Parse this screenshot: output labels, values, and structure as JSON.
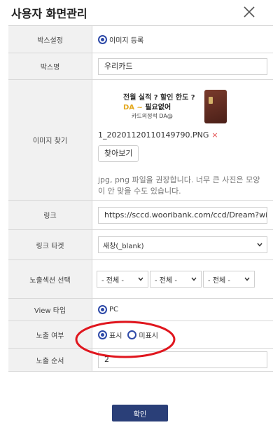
{
  "modal": {
    "title": "사용자 화면관리"
  },
  "form": {
    "box_setting": {
      "label": "박스설정",
      "option": "이미지 등록"
    },
    "box_name": {
      "label": "박스명",
      "value": "우리카드"
    },
    "image": {
      "label": "이미지 찾기",
      "banner": {
        "line1": "전월 실적 ?  할인 한도 ?",
        "line2_highlight": "DA ~",
        "line2_rest": " 필요없어",
        "line3": "카드의정석 DA@"
      },
      "filename": "1_20201120110149790.PNG",
      "remove_icon": "×",
      "find_button": "찾아보기",
      "hint": "jpg, png 파일을 권장합니다. 너무 큰 사진은 모양이 안 맞을 수도 있습니다."
    },
    "link": {
      "label": "링크",
      "value": "https://sccd.wooribank.com/ccd/Dream?withyou"
    },
    "link_target": {
      "label": "링크 타겟",
      "value": "새창(_blank)"
    },
    "exposure_section": {
      "label": "노출섹션 선택",
      "selects": [
        "- 전체 -",
        "- 전체 -",
        "- 전체 -"
      ]
    },
    "view_type": {
      "label": "View 타입",
      "option": "PC"
    },
    "display": {
      "label": "노출 여부",
      "options": [
        "표시",
        "미표시"
      ],
      "selected_index": 0
    },
    "order": {
      "label": "노출 순서",
      "value": "2"
    }
  },
  "confirm_button": "확인",
  "colors": {
    "accent": "#2e4aa8",
    "confirm_bg": "#2a3f78",
    "annotation": "#e0161e",
    "label_bg": "#f1f1f1"
  }
}
